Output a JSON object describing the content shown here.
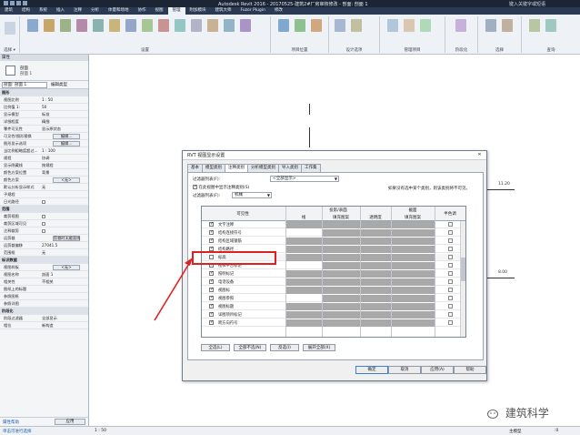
{
  "title_bar": {
    "text": "Autodesk Revit 2016  -  20170525-建筑2#厂房审核修改 - 剖面: 剖面 1",
    "sign_in": "键入关键字或短语"
  },
  "ribbon_tabs": [
    "建筑",
    "结构",
    "系统",
    "插入",
    "注释",
    "分析",
    "体量和场地",
    "协作",
    "视图",
    "管理",
    "附加模块",
    "建筑大师",
    "Fuzor Plugin",
    "修改"
  ],
  "ribbon_active_tab": "管理",
  "ribbon_groups": [
    {
      "label": "设置"
    },
    {
      "label": "项目位置"
    },
    {
      "label": "设计选项"
    },
    {
      "label": "管理项目"
    },
    {
      "label": "阶段化"
    },
    {
      "label": "选择"
    },
    {
      "label": "查询"
    }
  ],
  "select_label": "选择 ▾",
  "properties_panel": {
    "header": "属性",
    "type_name_1": "剖面",
    "type_name_2": "剖面 1",
    "instance_selector": "剖面: 剖面 1",
    "edit_type": "编辑类型",
    "rows": [
      {
        "k": "图形",
        "cat": true
      },
      {
        "k": "视图比例",
        "v": "1 : 50"
      },
      {
        "k": "比例值 1:",
        "v": "50"
      },
      {
        "k": "显示模型",
        "v": "标准"
      },
      {
        "k": "详细程度",
        "v": "精细"
      },
      {
        "k": "零件可见性",
        "v": "显示原状态"
      },
      {
        "k": "可见性/图形替换",
        "btn": "编辑..."
      },
      {
        "k": "图形显示选项",
        "btn": "编辑..."
      },
      {
        "k": "当比例粗略度超过...",
        "v": "1 : 100"
      },
      {
        "k": "规程",
        "v": "协调"
      },
      {
        "k": "显示隐藏线",
        "v": "按规程"
      },
      {
        "k": "颜色方案位置",
        "v": "背景"
      },
      {
        "k": "颜色方案",
        "btn": "<无>"
      },
      {
        "k": "默认分析显示样式",
        "v": "无"
      },
      {
        "k": "子规程",
        "v": ""
      },
      {
        "k": "日光路径",
        "cb": true
      },
      {
        "k": "范围",
        "cat": true
      },
      {
        "k": "裁剪视图",
        "cb": true
      },
      {
        "k": "裁剪区域可见",
        "cb": true
      },
      {
        "k": "注释裁剪",
        "cb": true
      },
      {
        "k": "远剪裁",
        "btn": "剪裁时无截面线"
      },
      {
        "k": "远剪裁偏移",
        "v": "27041.5"
      },
      {
        "k": "范围框",
        "v": "无"
      },
      {
        "k": "标识数据",
        "cat": true
      },
      {
        "k": "视图样板",
        "btn": "<无>"
      },
      {
        "k": "视图名称",
        "v": "剖面 1"
      },
      {
        "k": "相关性",
        "v": "不相关"
      },
      {
        "k": "图纸上的标题",
        "v": ""
      },
      {
        "k": "参照图纸",
        "v": ""
      },
      {
        "k": "参照详图",
        "v": ""
      },
      {
        "k": "阶段化",
        "cat": true
      },
      {
        "k": "阶段过滤器",
        "v": "全部显示"
      },
      {
        "k": "相位",
        "v": "新构造"
      }
    ],
    "help_link": "属性帮助",
    "apply_button": "应用"
  },
  "canvas_labels": {
    "level_top": "11.20",
    "level_bottom": "8.00"
  },
  "dialog": {
    "title": "RVT 视图显示设置",
    "close": "✕",
    "tabs": [
      "基本",
      "模型类别",
      "注释类别",
      "分析模型类别",
      "导入类别",
      "工作集"
    ],
    "active_tab": "注释类别",
    "filter_label": "过滤器列表(F):",
    "filter_value": "<全部显示>",
    "show_all_label": "在此视图中显示注释类别(S)",
    "filter_list_label": "过滤器列表(F):",
    "filter_list_value": "机械",
    "hint": "如果没有选中某个类别，则该类别将不可见。",
    "grid_headers": {
      "visibility": "可见性",
      "projection": "投影/表面",
      "cut": "截面",
      "halftone": "半色调",
      "lines": "线",
      "fill_pattern": "填充图案",
      "transparency": "透明度",
      "cut_fill": "填充图案"
    },
    "rows": [
      {
        "name": "文字注释",
        "checked": true
      },
      {
        "name": "结构连接符号",
        "checked": true
      },
      {
        "name": "结构区域钢筋",
        "checked": true
      },
      {
        "name": "结构路径",
        "checked": true
      },
      {
        "name": "标高",
        "checked": false
      },
      {
        "name": "楼梯平台标记",
        "checked": true
      },
      {
        "name": "照明标记",
        "checked": true
      },
      {
        "name": "电话设备",
        "checked": true
      },
      {
        "name": "视图标",
        "checked": true
      },
      {
        "name": "视图参照",
        "checked": true
      },
      {
        "name": "视图标题",
        "checked": true
      },
      {
        "name": "详图项目标记",
        "checked": true
      },
      {
        "name": "跨方向符号",
        "checked": true
      }
    ],
    "grid_buttons": [
      "全选(L)",
      "全部不选(N)",
      "反选(I)",
      "展开全部(X)"
    ],
    "footer_buttons": [
      "确定",
      "取消",
      "应用(A)",
      "帮助"
    ]
  },
  "status_bar": {
    "text": "单击可进行选择；按 Tab 键并单击可选择其他项目；按 Ctrl 键并单击可将新项目添加到选择集；按 Shift 键并单击可取消选择。",
    "scale": "1 : 50",
    "model": "主模型",
    "zoom": ":0"
  },
  "watermark": "建筑科学",
  "colors": {
    "highlight": "#e02020",
    "ribbon_dark": "#2b3a52",
    "grid_shade": "#a9a9a9"
  }
}
